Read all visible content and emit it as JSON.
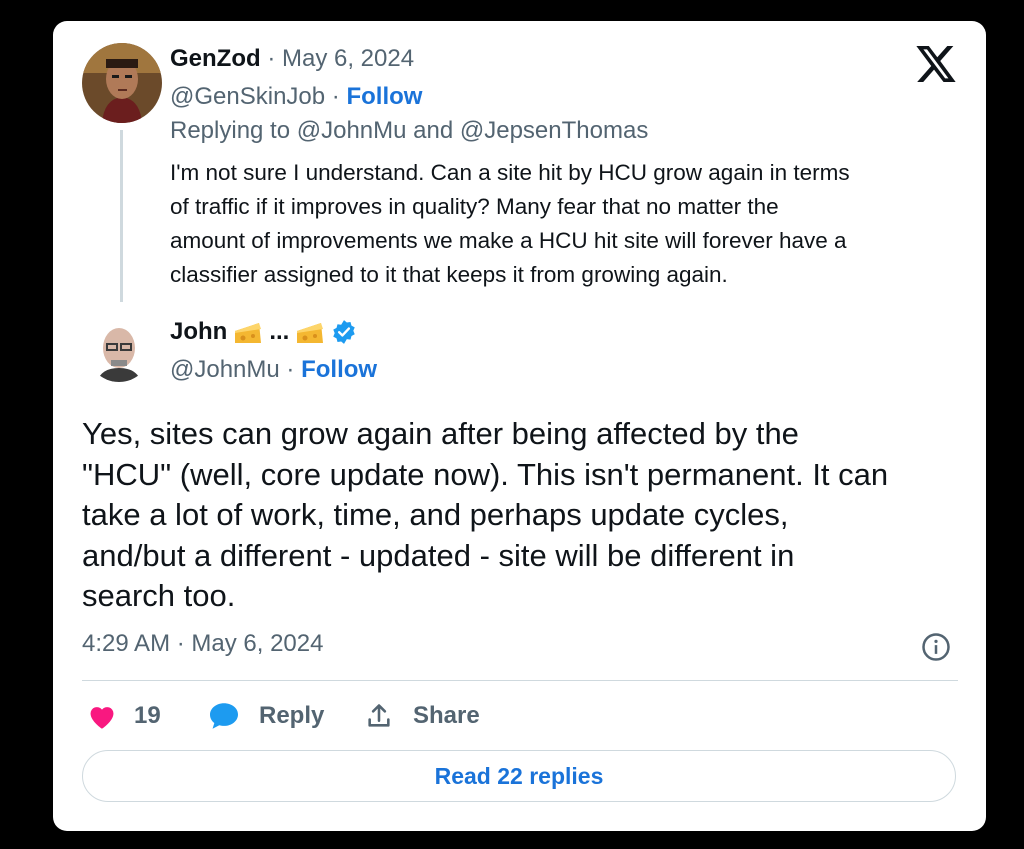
{
  "reply_tweet": {
    "author_name": "GenZod",
    "date": "· May 6, 2024",
    "handle": "@GenSkinJob",
    "follow_label": "Follow",
    "replying_to": "Replying to @JohnMu and @JepsenThomas",
    "text_lines": [
      "I'm not sure I understand. Can a site hit by HCU grow again in terms",
      "of traffic if it improves in quality? Many  fear that no matter the",
      "amount of improvements we make a HCU hit site will forever have a",
      "classifier assigned to it that keeps it from growing again."
    ]
  },
  "main_tweet": {
    "author_name": "John",
    "name_separator": "...",
    "handle": "@JohnMu",
    "follow_label": "Follow",
    "verified": true,
    "text_lines": [
      "Yes, sites can grow again after being affected by the",
      "\"HCU\" (well, core update now). This isn't permanent. It can",
      "take a lot of work, time, and perhaps update cycles,",
      "and/but a different - updated - site will be different in",
      "search too."
    ],
    "timestamp": "4:29 AM · May 6, 2024"
  },
  "actions": {
    "like_count": "19",
    "reply_label": "Reply",
    "share_label": "Share",
    "read_replies_label": "Read 22 replies"
  },
  "icons": [
    "x-logo-icon",
    "cheese-emoji-icon",
    "verified-badge-icon",
    "info-icon",
    "heart-icon",
    "reply-bubble-icon",
    "share-upload-icon"
  ],
  "colors": {
    "accent": "#1a73d9",
    "like": "#f91880",
    "verified": "#1d9bf0",
    "muted": "#536471"
  }
}
